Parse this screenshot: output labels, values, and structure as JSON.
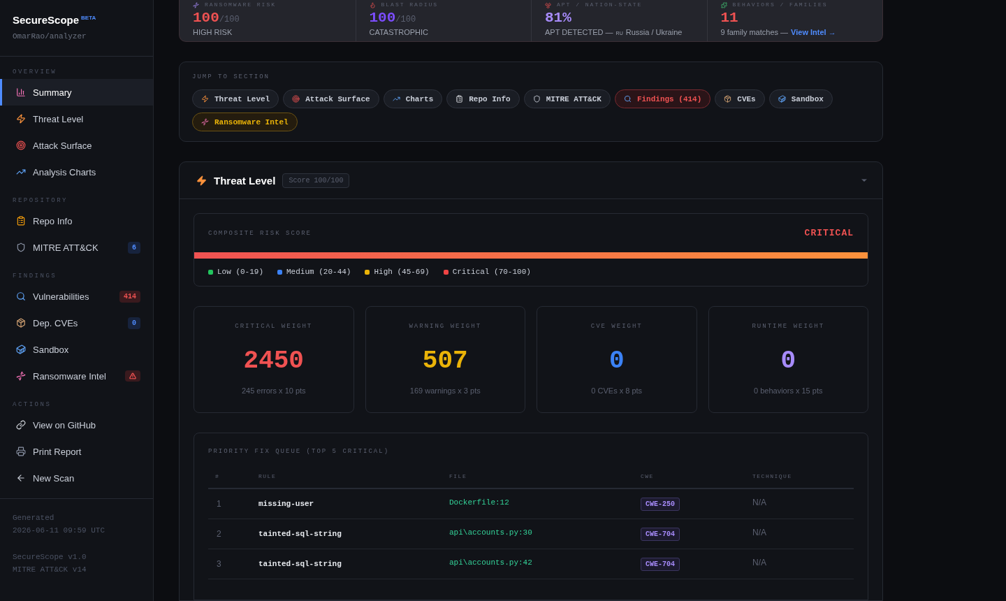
{
  "sidebar": {
    "brand": "SecureScope",
    "brand_tag": "BETA",
    "repo": "OmarRao/analyzer",
    "sections": [
      {
        "title": "OVERVIEW",
        "items": [
          {
            "label": "Summary",
            "selected": true
          },
          {
            "label": "Threat Level",
            "selected": false
          },
          {
            "label": "Attack Surface",
            "selected": false
          },
          {
            "label": "Analysis Charts",
            "selected": false
          }
        ]
      },
      {
        "title": "REPOSITORY",
        "items": [
          {
            "label": "Repo Info",
            "selected": false
          },
          {
            "label": "MITRE ATT&CK",
            "selected": false,
            "badge": {
              "kind": "info",
              "text": "6"
            }
          }
        ]
      },
      {
        "title": "FINDINGS",
        "items": [
          {
            "label": "Vulnerabilities",
            "selected": false,
            "badge": {
              "kind": "danger",
              "text": "414"
            }
          },
          {
            "label": "Dep. CVEs",
            "selected": false,
            "badge": {
              "kind": "info",
              "text": "0"
            }
          },
          {
            "label": "Sandbox",
            "selected": false
          },
          {
            "label": "Ransomware Intel",
            "selected": false,
            "badge": {
              "kind": "alert"
            }
          }
        ]
      },
      {
        "title": "ACTIONS",
        "items": [
          {
            "label": "View on GitHub",
            "selected": false
          },
          {
            "label": "Print Report",
            "selected": false
          },
          {
            "label": "New Scan",
            "selected": false
          }
        ]
      }
    ],
    "footer": [
      [
        "Generated",
        "2026-06-11 09:59 UTC"
      ],
      [
        "SecureScope v1.0",
        "MITRE ATT&CK v14"
      ]
    ]
  },
  "stats": [
    {
      "label": "RANSOMWARE RISK",
      "value": "100",
      "suffix": "/100",
      "color": "#f05252",
      "caption": "HIGH RISK"
    },
    {
      "label": "BLAST RADIUS",
      "value": "100",
      "suffix": "/100",
      "color": "#7c4dff",
      "caption": "CATASTROPHIC"
    },
    {
      "label": "APT / NATION-STATE",
      "value": "81%",
      "color": "#a78bfa",
      "caption": "APT DETECTED —",
      "tag": "RU",
      "caption_end": "Russia / Ukraine"
    },
    {
      "label": "BEHAVIORS / FAMILIES",
      "value": "11",
      "color": "#f05252",
      "caption": "9 family matches —",
      "link": "View Intel →"
    }
  ],
  "jump": {
    "title": "JUMP TO SECTION",
    "chips": [
      {
        "label": "Threat Level",
        "kind": "default"
      },
      {
        "label": "Attack Surface",
        "kind": "default"
      },
      {
        "label": "Charts",
        "kind": "default"
      },
      {
        "label": "Repo Info",
        "kind": "default"
      },
      {
        "label": "MITRE ATT&CK",
        "kind": "default"
      },
      {
        "label": "Findings (414)",
        "kind": "danger"
      },
      {
        "label": "CVEs",
        "kind": "default"
      },
      {
        "label": "Sandbox",
        "kind": "default"
      },
      {
        "label": "Ransomware Intel",
        "kind": "warning"
      }
    ]
  },
  "threat": {
    "title": "Threat Level",
    "score": "Score 100/100",
    "expanded": true,
    "composite": {
      "title": "COMPOSITE RISK SCORE",
      "rating": "CRITICAL",
      "level": 1,
      "legend": [
        {
          "label": "Low (0-19)",
          "color": "#22c55e"
        },
        {
          "label": "Medium (20-44)",
          "color": "#3b82f6"
        },
        {
          "label": "High (45-69)",
          "color": "#eab308"
        },
        {
          "label": "Critical (70-100)",
          "color": "#ef4444"
        }
      ]
    },
    "weights": [
      {
        "label": "CRITICAL WEIGHT",
        "value": "2450",
        "caption": "245 errors x 10 pts",
        "color": "#f05252"
      },
      {
        "label": "WARNING WEIGHT",
        "value": "507",
        "caption": "169 warnings x 3 pts",
        "color": "#eab308"
      },
      {
        "label": "CVE WEIGHT",
        "value": "0",
        "caption": "0 CVEs x 8 pts",
        "color": "#3b82f6"
      },
      {
        "label": "RUNTIME WEIGHT",
        "value": "0",
        "caption": "0 behaviors x 15 pts",
        "color": "#a78bfa"
      }
    ],
    "queue": {
      "title": "PRIORITY FIX QUEUE (TOP 5 CRITICAL)",
      "columns": [
        "#",
        "RULE",
        "FILE",
        "CWE",
        "TECHNIQUE"
      ],
      "rows": [
        {
          "num": "1",
          "rule": "missing-user",
          "file": "Dockerfile:12",
          "cwe": "CWE-250",
          "technique": "N/A"
        },
        {
          "num": "2",
          "rule": "tainted-sql-string",
          "file": "api\\accounts.py:30",
          "cwe": "CWE-704",
          "technique": "N/A"
        },
        {
          "num": "3",
          "rule": "tainted-sql-string",
          "file": "api\\accounts.py:42",
          "cwe": "CWE-704",
          "technique": "N/A"
        }
      ]
    }
  }
}
